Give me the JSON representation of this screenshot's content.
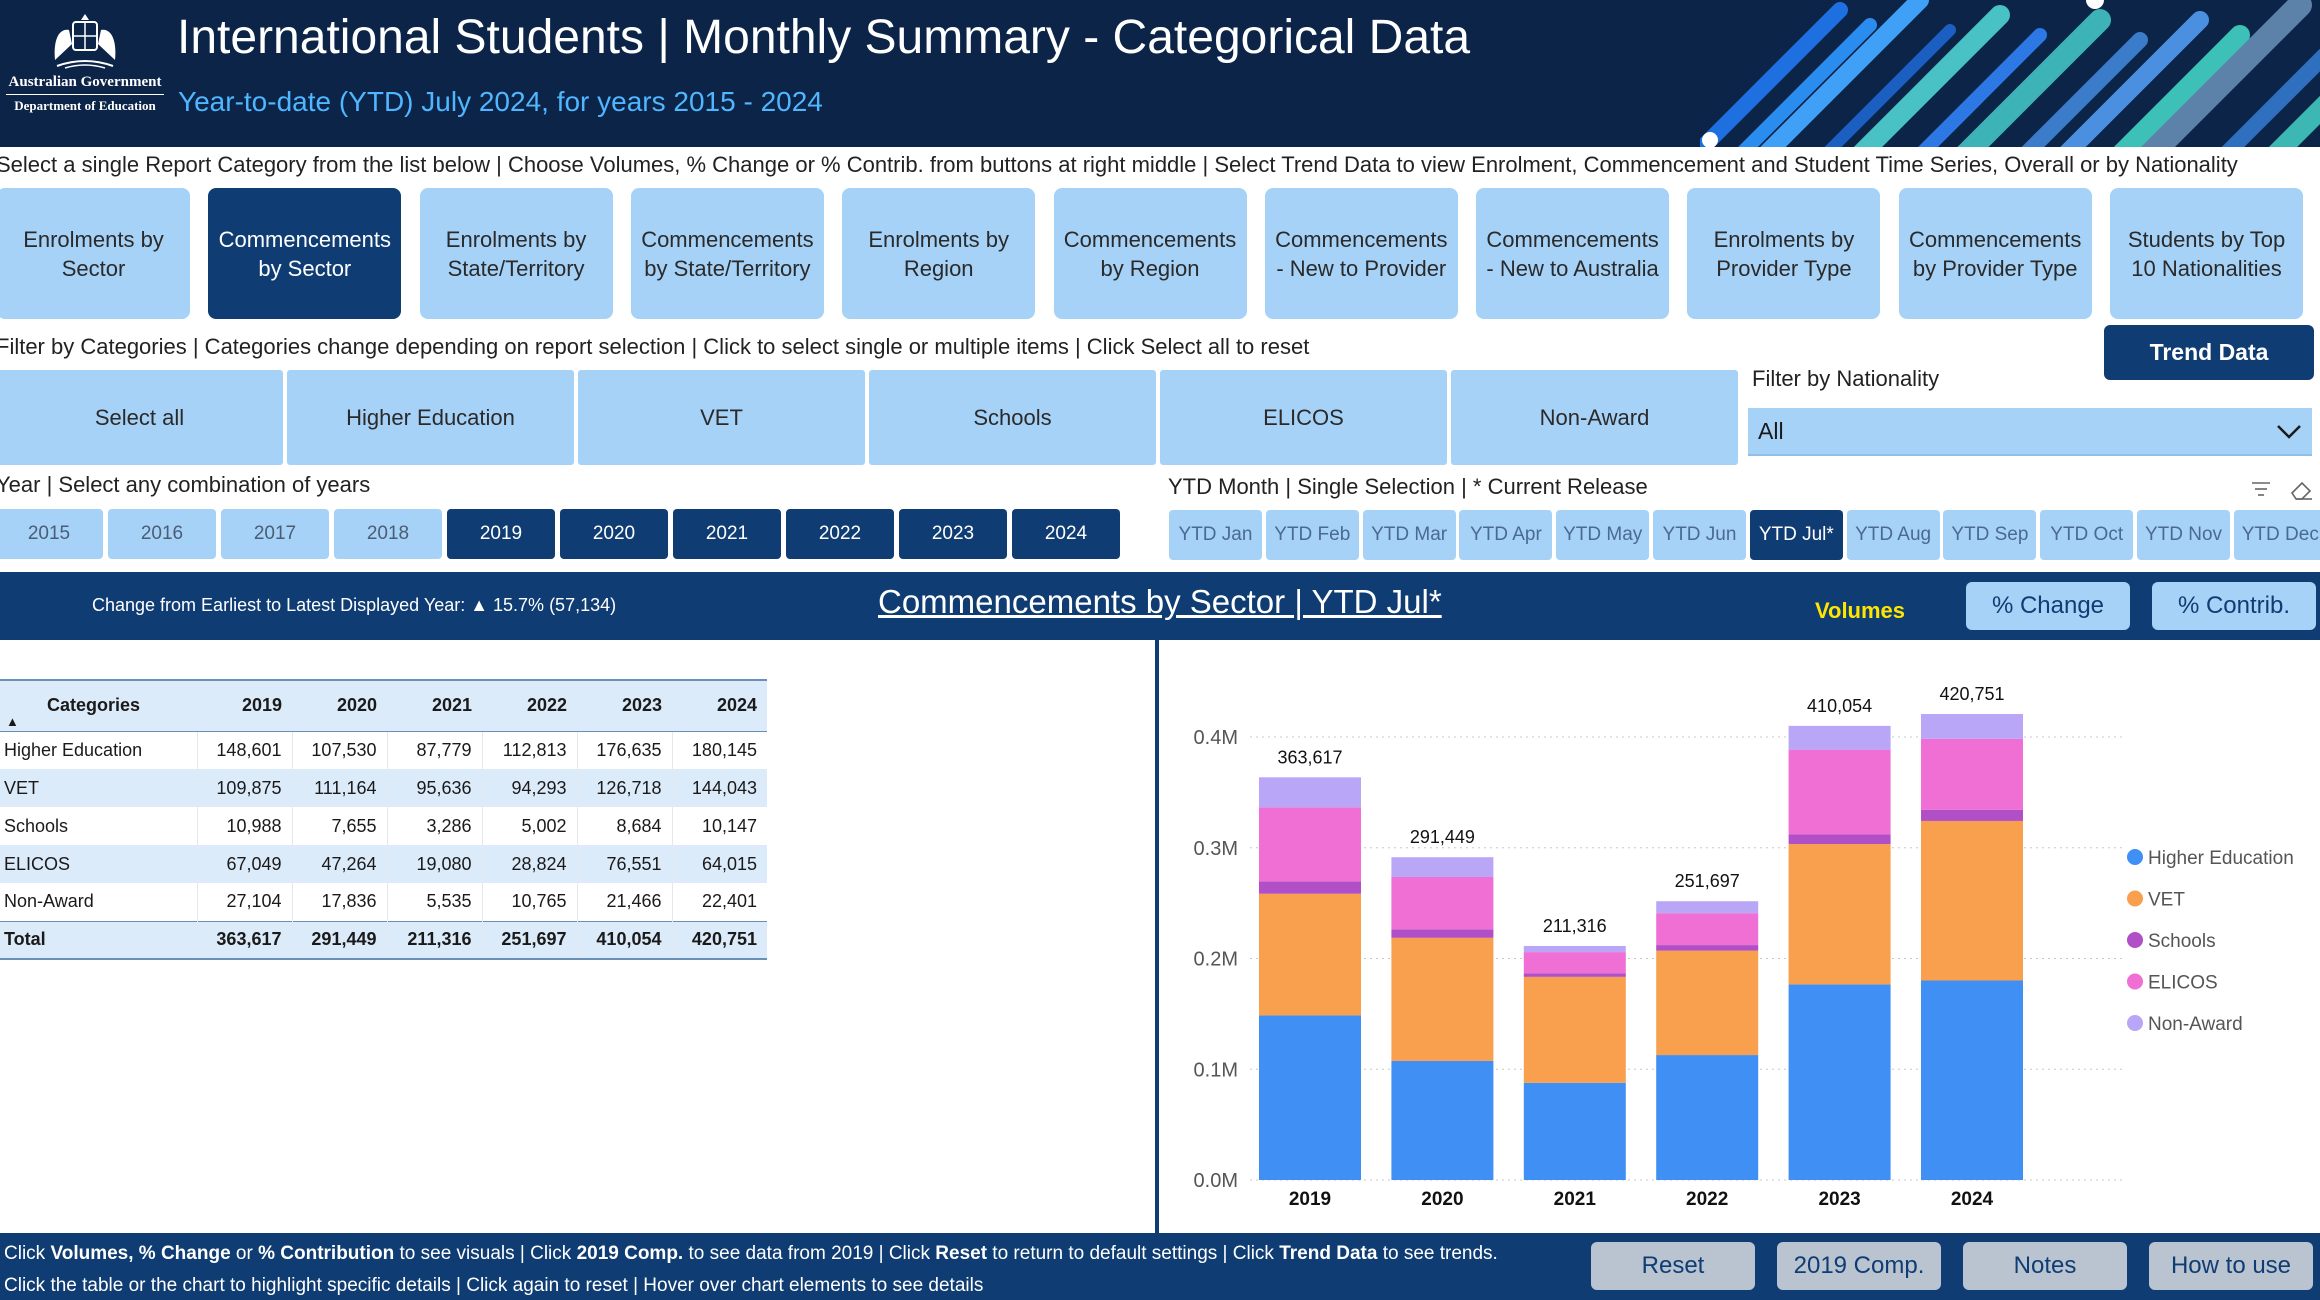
{
  "header": {
    "logo_line1": "Australian Government",
    "logo_line2": "Department of Education",
    "title": "International Students | Monthly Summary - Categorical Data",
    "subtitle": "Year-to-date (YTD) July 2024, for years 2015 - 2024"
  },
  "instructions": {
    "report": "Select a single Report Category from the list below | Choose Volumes, % Change or % Contrib. from buttons at right middle | Select Trend Data to view Enrolment, Commencement and Student Time Series, Overall or by Nationality",
    "filter": "Filter by Categories | Categories change depending on report selection | Click to select single or multiple items | Click Select all to reset",
    "year": "Year | Select any combination of years",
    "month": "YTD Month | Single Selection | * Current Release"
  },
  "report_categories": [
    "Enrolments by Sector",
    "Commencements by Sector",
    "Enrolments by State/Territory",
    "Commencements by State/Territory",
    "Enrolments by Region",
    "Commencements by Region",
    "Commencements - New to Provider",
    "Commencements - New to Australia",
    "Enrolments by Provider Type",
    "Commencements by Provider Type",
    "Students by Top 10 Nationalities"
  ],
  "trend_button": "Trend Data",
  "category_filters": [
    "Select all",
    "Higher Education",
    "VET",
    "Schools",
    "ELICOS",
    "Non-Award"
  ],
  "nationality": {
    "label": "Filter by Nationality",
    "value": "All"
  },
  "years": [
    "2015",
    "2016",
    "2017",
    "2018",
    "2019",
    "2020",
    "2021",
    "2022",
    "2023",
    "2024"
  ],
  "months": [
    "YTD Jan",
    "YTD Feb",
    "YTD Mar",
    "YTD Apr",
    "YTD May",
    "YTD Jun",
    "YTD Jul*",
    "YTD Aug",
    "YTD Sep",
    "YTD Oct",
    "YTD Nov",
    "YTD Dec"
  ],
  "band": {
    "change_text": "Change from Earliest to Latest Displayed Year: ▲ 15.7% (57,134)",
    "report_title": "Commencements by Sector | YTD Jul*",
    "volumes": "Volumes",
    "pct_change": "% Change",
    "pct_contrib": "% Contrib."
  },
  "table": {
    "headers": [
      "Categories",
      "2019",
      "2020",
      "2021",
      "2022",
      "2023",
      "2024"
    ],
    "rows": [
      [
        "Higher Education",
        "148,601",
        "107,530",
        "87,779",
        "112,813",
        "176,635",
        "180,145"
      ],
      [
        "VET",
        "109,875",
        "111,164",
        "95,636",
        "94,293",
        "126,718",
        "144,043"
      ],
      [
        "Schools",
        "10,988",
        "7,655",
        "3,286",
        "5,002",
        "8,684",
        "10,147"
      ],
      [
        "ELICOS",
        "67,049",
        "47,264",
        "19,080",
        "28,824",
        "76,551",
        "64,015"
      ],
      [
        "Non-Award",
        "27,104",
        "17,836",
        "5,535",
        "10,765",
        "21,466",
        "22,401"
      ]
    ],
    "total": [
      "Total",
      "363,617",
      "291,449",
      "211,316",
      "251,697",
      "410,054",
      "420,751"
    ]
  },
  "chart_data": {
    "type": "bar",
    "stacked": true,
    "categories": [
      "2019",
      "2020",
      "2021",
      "2022",
      "2023",
      "2024"
    ],
    "series": [
      {
        "name": "Higher Education",
        "color": "#3f8ff5",
        "values": [
          148601,
          107530,
          87779,
          112813,
          176635,
          180145
        ]
      },
      {
        "name": "VET",
        "color": "#f9a04e",
        "values": [
          109875,
          111164,
          95636,
          94293,
          126718,
          144043
        ]
      },
      {
        "name": "Schools",
        "color": "#b04fc6",
        "values": [
          10988,
          7655,
          3286,
          5002,
          8684,
          10147
        ]
      },
      {
        "name": "ELICOS",
        "color": "#ef6fd4",
        "values": [
          67049,
          47264,
          19080,
          28824,
          76551,
          64015
        ]
      },
      {
        "name": "Non-Award",
        "color": "#b9a6f6",
        "values": [
          27104,
          17836,
          5535,
          10765,
          21466,
          22401
        ]
      }
    ],
    "totals": [
      "363,617",
      "291,449",
      "211,316",
      "251,697",
      "410,054",
      "420,751"
    ],
    "yticks": [
      "0.0M",
      "0.1M",
      "0.2M",
      "0.3M",
      "0.4M"
    ],
    "ylim": [
      0,
      400000
    ],
    "legend": "right",
    "grid": true
  },
  "footer": {
    "line1_html": "Click <b>Volumes, % Change</b> or <b>% Contribution</b> to see visuals | Click <b>2019 Comp.</b> to see data from 2019 | Click <b>Reset</b> to return to default settings | Click <b>Trend Data</b> to see trends.",
    "line2": "Click the table or the chart to highlight specific details  |  Click again to reset  |  Hover over chart elements to see details",
    "buttons": [
      "Reset",
      "2019 Comp.",
      "Notes",
      "How to use"
    ]
  }
}
